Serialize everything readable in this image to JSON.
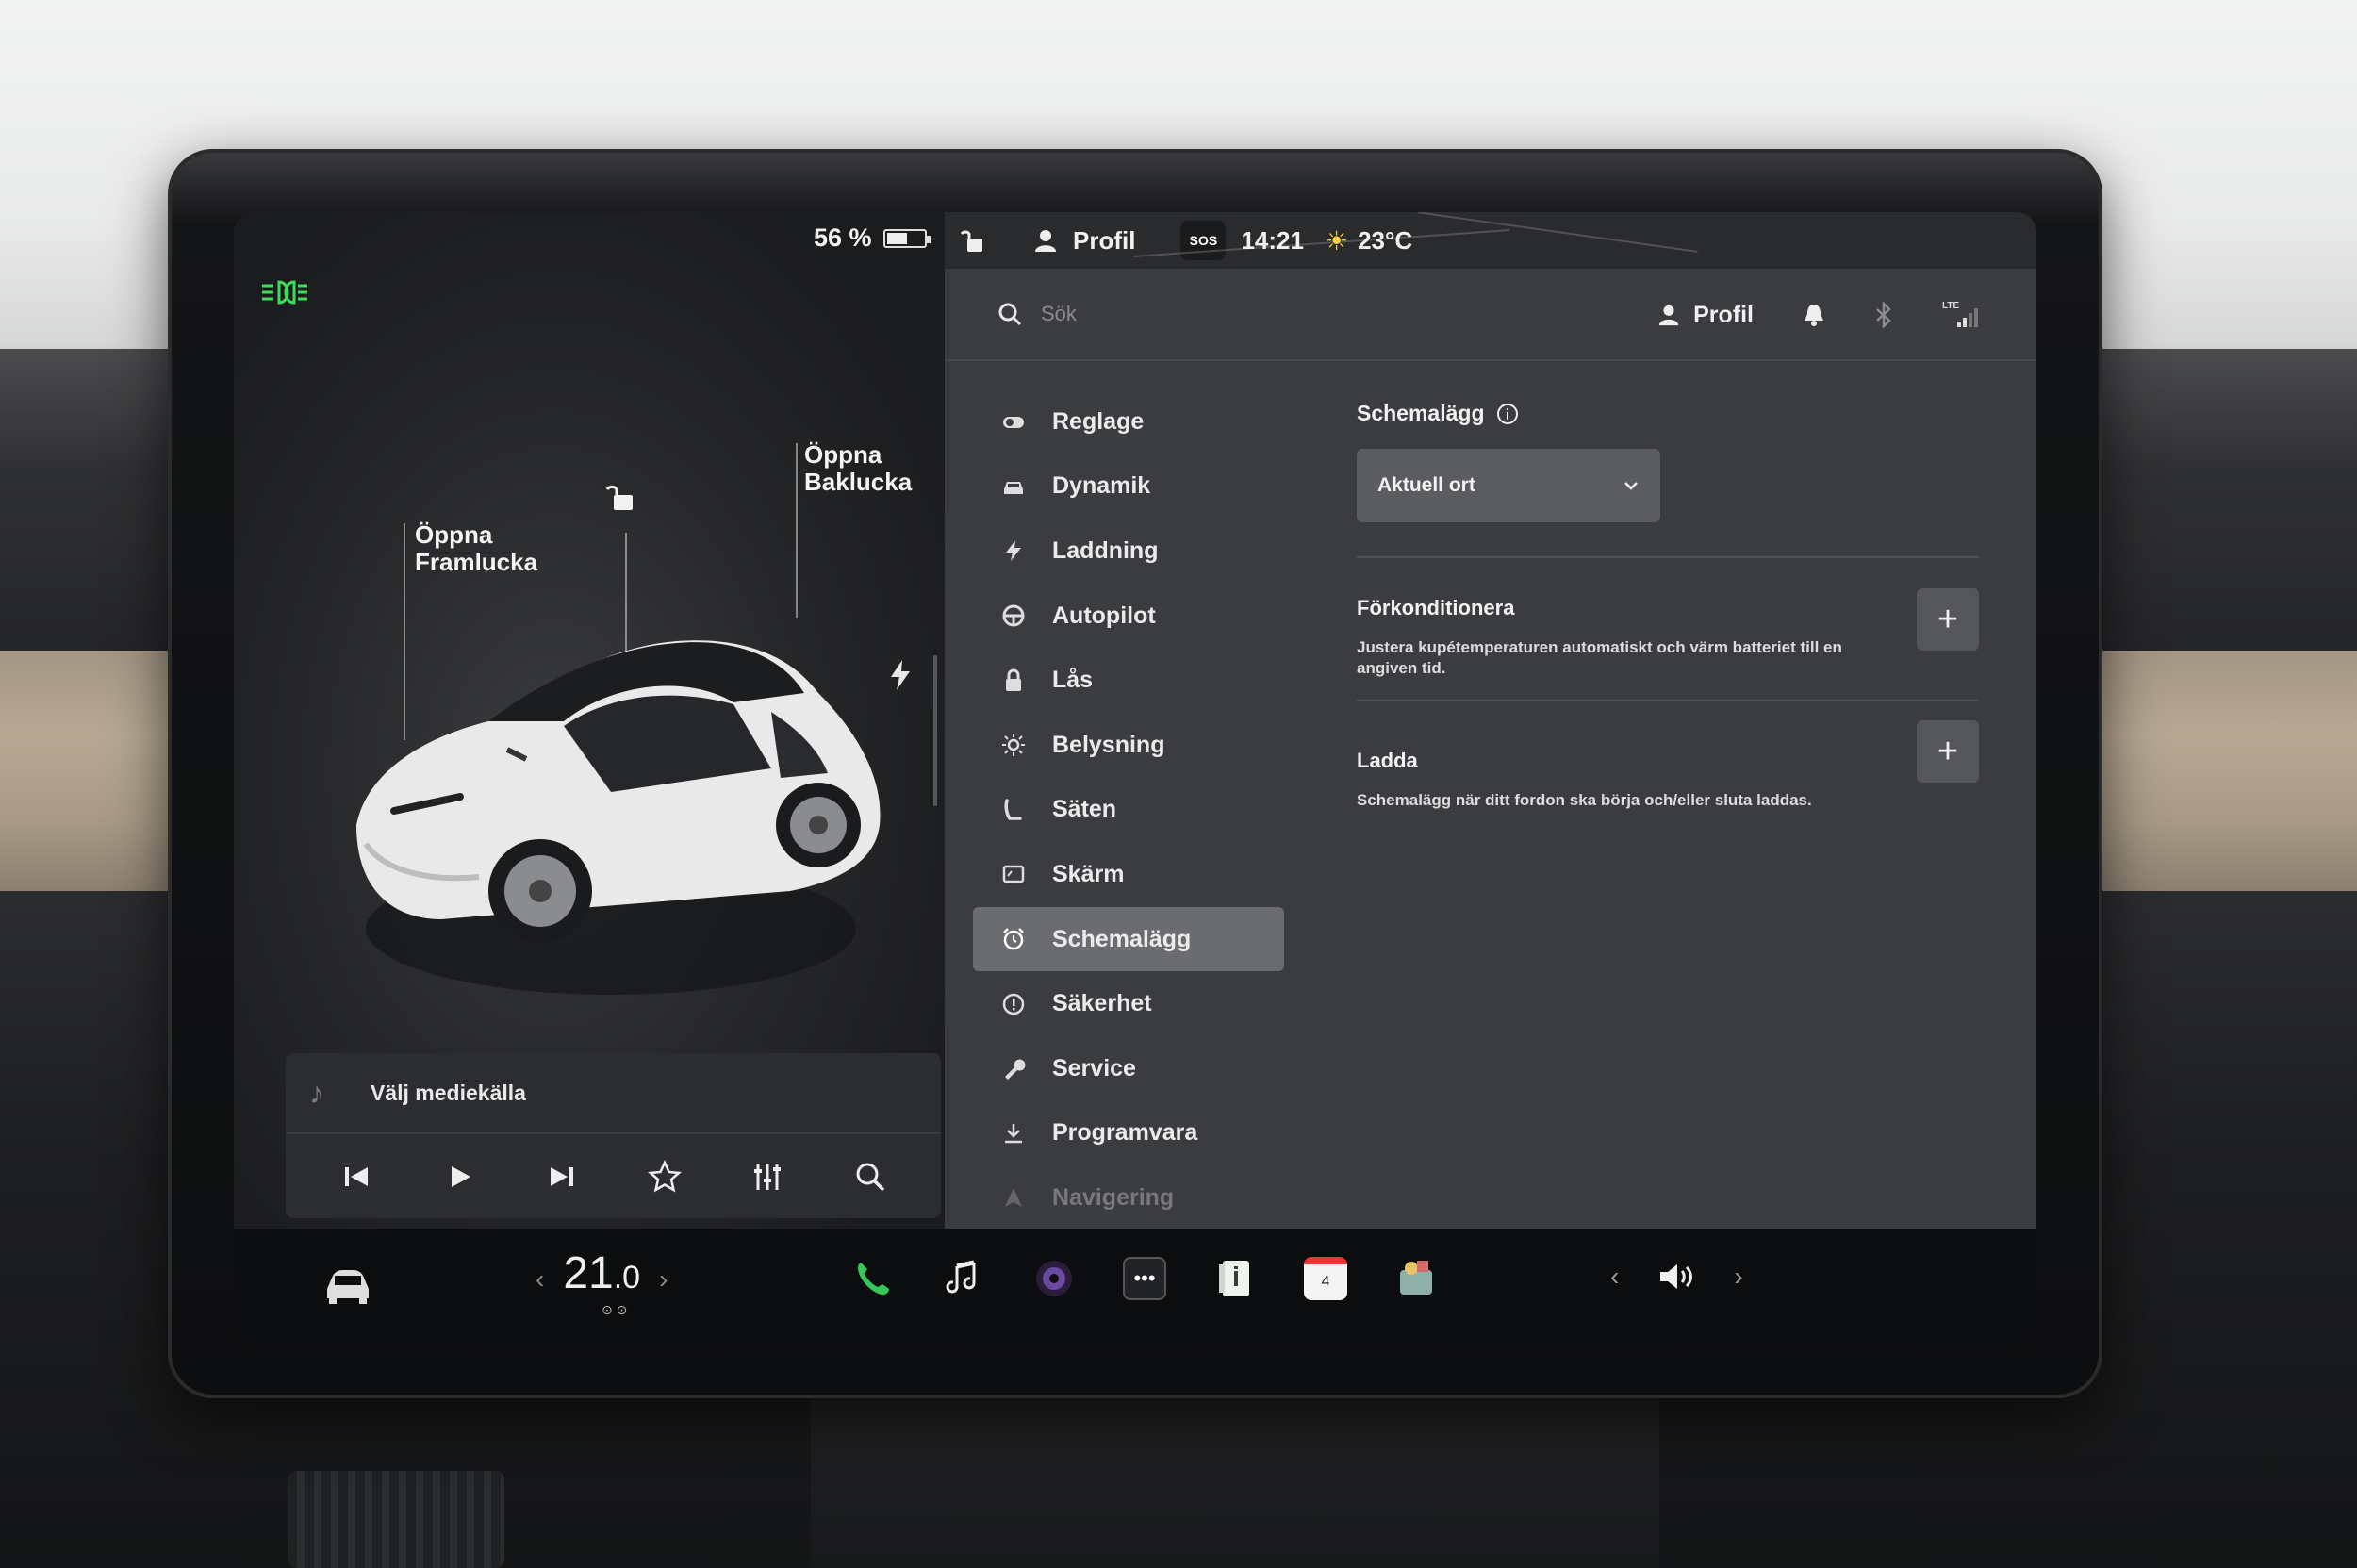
{
  "status": {
    "battery_percent_label": "56 %",
    "battery_level": 0.56,
    "profile_label": "Profil",
    "sos_label": "SOS",
    "time": "14:21",
    "weather_temp": "23°C"
  },
  "car_view": {
    "front_trunk_label": "Öppna\nFramlucka",
    "rear_trunk_label": "Öppna\nBaklucka"
  },
  "media": {
    "source_label": "Välj mediekälla"
  },
  "search": {
    "placeholder": "Sök",
    "profile_label": "Profil",
    "lte_label": "LTE"
  },
  "menu": {
    "items": [
      {
        "label": "Reglage",
        "icon": "toggle-icon"
      },
      {
        "label": "Dynamik",
        "icon": "car-icon"
      },
      {
        "label": "Laddning",
        "icon": "bolt-icon"
      },
      {
        "label": "Autopilot",
        "icon": "steering-wheel-icon"
      },
      {
        "label": "Lås",
        "icon": "lock-icon"
      },
      {
        "label": "Belysning",
        "icon": "sun-icon"
      },
      {
        "label": "Säten",
        "icon": "seat-icon"
      },
      {
        "label": "Skärm",
        "icon": "display-icon"
      },
      {
        "label": "Schemalägg",
        "icon": "alarm-clock-icon"
      },
      {
        "label": "Säkerhet",
        "icon": "info-circle-icon"
      },
      {
        "label": "Service",
        "icon": "wrench-icon"
      },
      {
        "label": "Programvara",
        "icon": "download-icon"
      },
      {
        "label": "Navigering",
        "icon": "navigation-arrow-icon"
      }
    ],
    "active": "Schemalägg"
  },
  "schedule": {
    "title": "Schemalägg",
    "location_select": "Aktuell ort",
    "precondition": {
      "title": "Förkonditionera",
      "description": "Justera kupétemperaturen automatiskt och värm batteriet till en angiven tid."
    },
    "charge": {
      "title": "Ladda",
      "description": "Schemalägg när ditt fordon ska börja och/eller sluta laddas."
    }
  },
  "dock": {
    "temp_whole": "21",
    "temp_decimal": ".0",
    "calendar_day": "4"
  },
  "colors": {
    "headlight_green": "#3ddc5a",
    "phone_green": "#35c759",
    "active_menu_bg": "#6b6c70"
  }
}
